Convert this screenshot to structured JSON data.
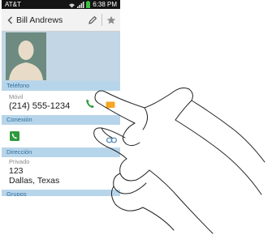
{
  "status_bar": {
    "carrier": "AT&T",
    "time": "6:38 PM"
  },
  "action_bar": {
    "contact_name": "Bill Andrews",
    "icons": [
      "back-icon",
      "pencil-icon",
      "star-icon"
    ]
  },
  "sections": {
    "phone": {
      "header": "Teléfono",
      "type_label": "Móvil",
      "number": "(214) 555-1234"
    },
    "connection": {
      "header": "Conexión"
    },
    "address": {
      "header": "Dirección",
      "type_label": "Privado",
      "line1": "123",
      "line2": "Dallas, Texas"
    },
    "groups": {
      "header": "Grupos"
    }
  },
  "colors": {
    "section_header_bg": "#b7d5ea",
    "section_header_text": "#2f6f9c",
    "profile_bg": "#c2d6e5",
    "call_green": "#2e9a3e",
    "message_orange": "#f5a623"
  }
}
